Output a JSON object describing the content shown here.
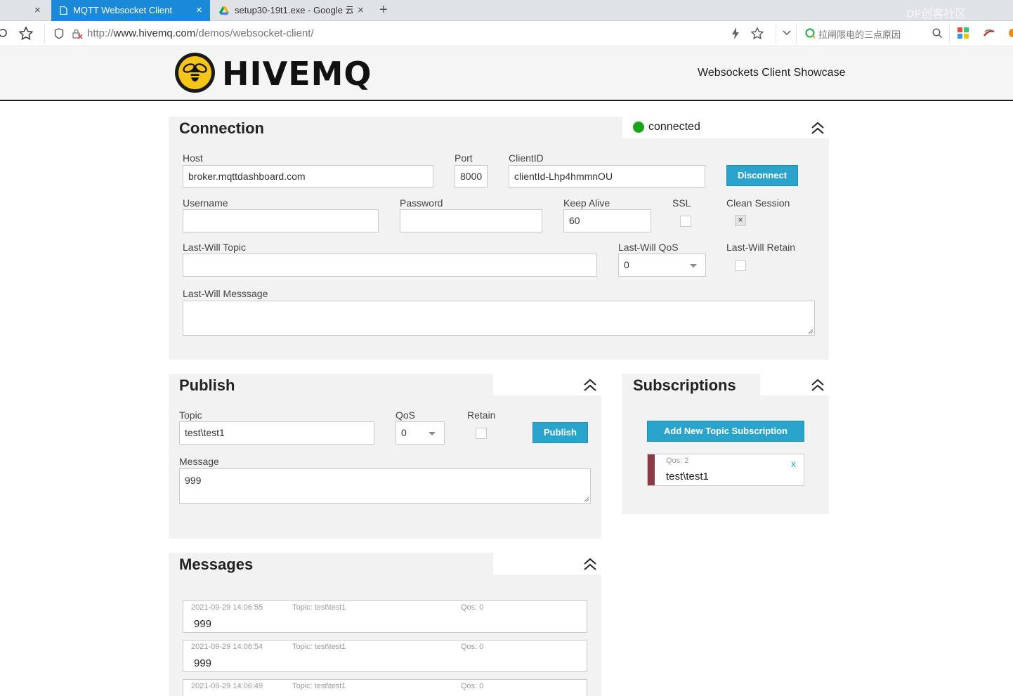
{
  "browser": {
    "tabs": [
      {
        "label": "MQTT Websocket Client",
        "active": true
      },
      {
        "label": "setup30-19t1.exe - Google 云",
        "active": false
      }
    ],
    "close_glyph": "×",
    "new_tab_glyph": "+",
    "url_prefix": "http://",
    "url_host": "www.hivemq.com",
    "url_path": "/demos/websocket-client/",
    "search_text": "拉闸限电的三点原因",
    "watermark": "DF创客社区",
    "icons": [
      "refresh-icon",
      "star-icon",
      "shield-icon",
      "lock-warning-icon",
      "lightning-icon",
      "bookmark-star-icon",
      "chevron-down-icon",
      "search-engine-icon",
      "search-icon",
      "apps-icon",
      "extension-icon"
    ]
  },
  "header": {
    "logo_text": "HIVEMQ",
    "showcase": "Websockets Client Showcase",
    "brand_yellow": "#f5c518"
  },
  "connection": {
    "title": "Connection",
    "status": "connected",
    "status_color": "#1ba31b",
    "host_label": "Host",
    "host_value": "broker.mqttdashboard.com",
    "port_label": "Port",
    "port_value": "8000",
    "clientid_label": "ClientID",
    "clientid_value": "clientId-Lhp4hmmnOU",
    "disconnect_label": "Disconnect",
    "username_label": "Username",
    "username_value": "",
    "password_label": "Password",
    "password_value": "",
    "keepalive_label": "Keep Alive",
    "keepalive_value": "60",
    "ssl_label": "SSL",
    "ssl_checked": false,
    "clean_session_label": "Clean Session",
    "clean_session_checked": true,
    "check_glyph": "×",
    "lastwill_topic_label": "Last-Will Topic",
    "lastwill_topic_value": "",
    "lastwill_qos_label": "Last-Will QoS",
    "lastwill_qos_value": "0",
    "lastwill_retain_label": "Last-Will Retain",
    "lastwill_retain_checked": false,
    "lastwill_message_label": "Last-Will Messsage",
    "lastwill_message_value": ""
  },
  "publish": {
    "title": "Publish",
    "topic_label": "Topic",
    "topic_value": "test\\test1",
    "qos_label": "QoS",
    "qos_value": "0",
    "retain_label": "Retain",
    "retain_checked": false,
    "publish_label": "Publish",
    "message_label": "Message",
    "message_value": "999"
  },
  "subscriptions": {
    "title": "Subscriptions",
    "add_label": "Add New Topic Subscription",
    "items": [
      {
        "qos": "Qos: 2",
        "topic": "test\\test1",
        "color": "#8a3b45",
        "remove": "x"
      }
    ]
  },
  "messages": {
    "title": "Messages",
    "items": [
      {
        "time": "2021-09-29 14:06:55",
        "topic": "Topic: test\\test1",
        "qos": "Qos: 0",
        "payload": "999"
      },
      {
        "time": "2021-09-29 14:06:54",
        "topic": "Topic: test\\test1",
        "qos": "Qos: 0",
        "payload": "999"
      },
      {
        "time": "2021-09-29 14:06:49",
        "topic": "Topic: test\\test1",
        "qos": "Qos: 0",
        "payload": ""
      }
    ]
  }
}
